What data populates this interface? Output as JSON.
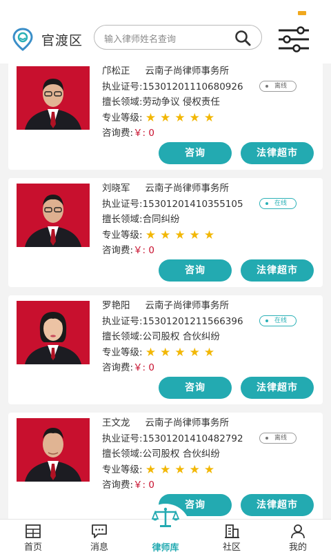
{
  "header": {
    "location": "官渡区",
    "search_placeholder": "输入律师姓名查询"
  },
  "labels": {
    "license": "执业证号:",
    "field": "擅长领域:",
    "level": "专业等级:",
    "fee": "咨询费:",
    "consult_btn": "咨询",
    "market_btn": "法律超市"
  },
  "lawyers": [
    {
      "name": "邝松正",
      "firm": "云南子尚律师事务所",
      "license": "15301201110680926",
      "field": "劳动争议 侵权责任",
      "fee": "￥: 0",
      "status": "离线",
      "online": false,
      "stars": 5
    },
    {
      "name": "刘晓军",
      "firm": "云南子尚律师事务所",
      "license": "15301201410355105",
      "field": "合同纠纷",
      "fee": "￥: 0",
      "status": "在线",
      "online": true,
      "stars": 5
    },
    {
      "name": "罗艳阳",
      "firm": "云南子尚律师事务所",
      "license": "15301201211566396",
      "field": "公司股权 合伙纠纷",
      "fee": "￥: 0",
      "status": "在线",
      "online": true,
      "stars": 5
    },
    {
      "name": "王文龙",
      "firm": "云南子尚律师事务所",
      "license": "15301201410482792",
      "field": "公司股权 合伙纠纷",
      "fee": "￥: 0",
      "status": "离线",
      "online": false,
      "stars": 5
    }
  ],
  "nav": [
    {
      "label": "首页",
      "icon": "home-icon"
    },
    {
      "label": "消息",
      "icon": "message-icon"
    },
    {
      "label": "律师库",
      "icon": "scales-icon",
      "active": true
    },
    {
      "label": "社区",
      "icon": "community-icon"
    },
    {
      "label": "我的",
      "icon": "user-icon"
    }
  ],
  "colors": {
    "accent": "#23aab1",
    "fee": "#c8102e",
    "star": "#f2b705",
    "photo_bg": "#c8102e"
  }
}
